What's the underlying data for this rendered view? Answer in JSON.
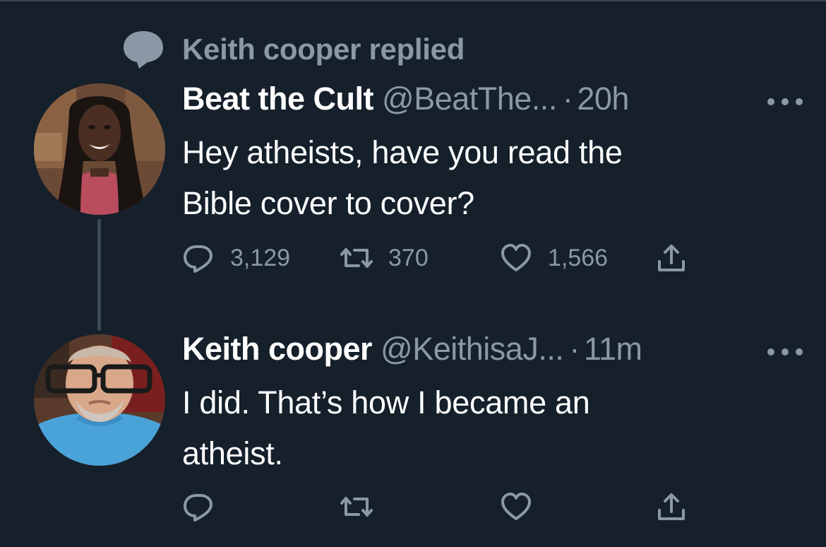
{
  "context": {
    "icon": "speech-bubble-icon",
    "text": "Keith cooper replied"
  },
  "tweets": [
    {
      "name": "Beat the Cult",
      "handle": "@BeatThe...",
      "separator": "·",
      "time": "20h",
      "lines": [
        "Hey atheists, have you read the",
        "Bible cover to cover?"
      ],
      "replies": "3,129",
      "retweets": "370",
      "likes": "1,566"
    },
    {
      "name": "Keith cooper",
      "handle": "@KeithisaJ...",
      "separator": "·",
      "time": "11m",
      "lines": [
        "I did. That’s how I became an",
        "atheist."
      ]
    }
  ],
  "colors": {
    "background": "#15202b",
    "secondary_text": "#8b98a5",
    "primary_text": "#ffffff",
    "thread_line": "#3d4a56"
  }
}
